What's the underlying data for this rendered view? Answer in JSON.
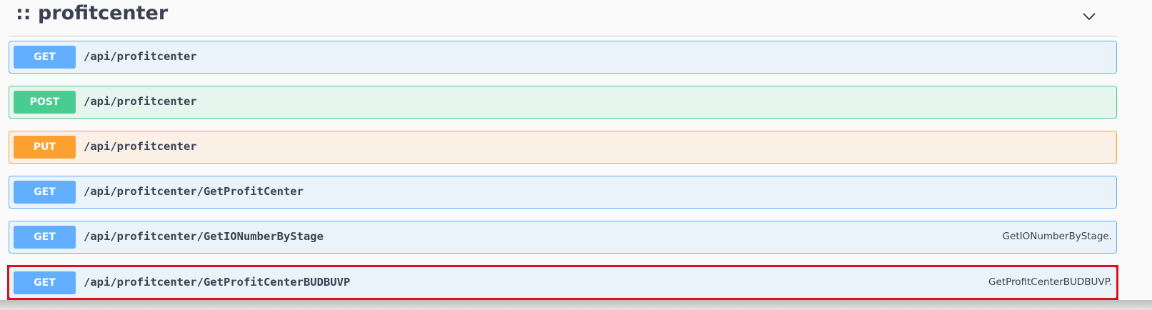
{
  "section": {
    "title": ":: profitcenter",
    "collapse_icon": "chevron-down-icon"
  },
  "operations": [
    {
      "method": "GET",
      "path": "/api/profitcenter",
      "summary": ""
    },
    {
      "method": "POST",
      "path": "/api/profitcenter",
      "summary": ""
    },
    {
      "method": "PUT",
      "path": "/api/profitcenter",
      "summary": ""
    },
    {
      "method": "GET",
      "path": "/api/profitcenter/GetProfitCenter",
      "summary": ""
    },
    {
      "method": "GET",
      "path": "/api/profitcenter/GetIONumberByStage",
      "summary": "GetIONumberByStage."
    },
    {
      "method": "GET",
      "path": "/api/profitcenter/GetProfitCenterBUDBUVP",
      "summary": "GetProfitCenterBUDBUVP."
    }
  ],
  "colors": {
    "get": "#61affe",
    "post": "#49cc90",
    "put": "#fca130",
    "highlight": "#d9121c"
  }
}
